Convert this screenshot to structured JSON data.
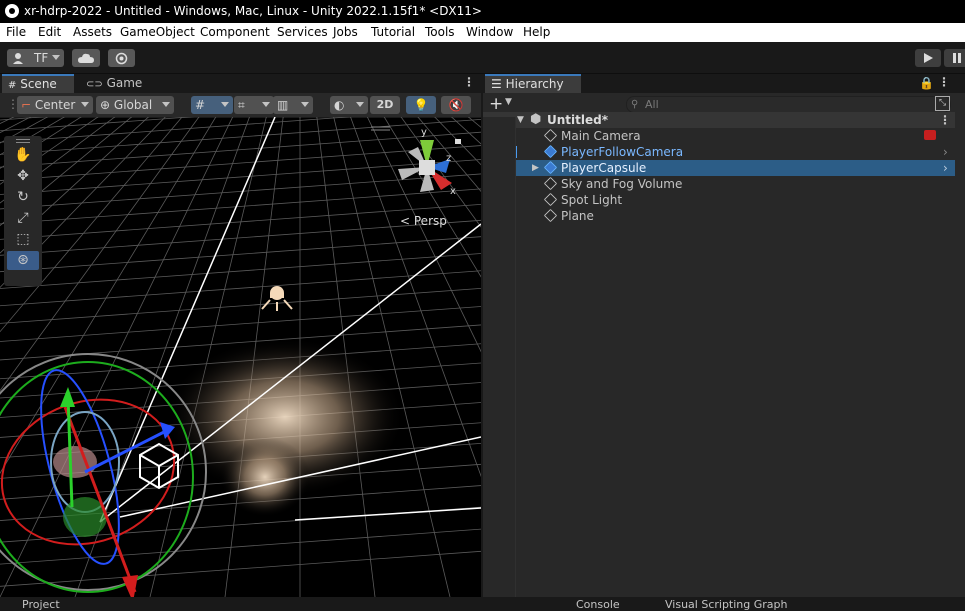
{
  "window": {
    "title": "xr-hdrp-2022 - Untitled - Windows, Mac, Linux - Unity 2022.1.15f1* <DX11>"
  },
  "menu": [
    "File",
    "Edit",
    "Assets",
    "GameObject",
    "Component",
    "Services",
    "Jobs",
    "Tutorial",
    "Tools",
    "Window",
    "Help"
  ],
  "toolbar": {
    "account_label": "TF"
  },
  "scene": {
    "tabs": [
      "Scene",
      "Game"
    ],
    "pivot_mode": "Center",
    "pivot_rotation": "Global",
    "mode_2d": "2D",
    "view_label": "Persp",
    "axis_labels": {
      "x": "x",
      "y": "y",
      "z": "z"
    }
  },
  "hierarchy": {
    "tab": "Hierarchy",
    "search_placeholder": "All",
    "scene_name": "Untitled*",
    "items": [
      {
        "label": "Main Camera"
      },
      {
        "label": "PlayerFollowCamera"
      },
      {
        "label": "PlayerCapsule"
      },
      {
        "label": "Sky and Fog Volume"
      },
      {
        "label": "Spot Light"
      },
      {
        "label": "Plane"
      }
    ]
  },
  "bottom_tabs": [
    "Project",
    "Console",
    "Visual Scripting Graph"
  ],
  "colors": {
    "selection": "#2c5d87",
    "accent_blue": "#4a9bf0",
    "prefab_blue": "#7ab8ff"
  }
}
